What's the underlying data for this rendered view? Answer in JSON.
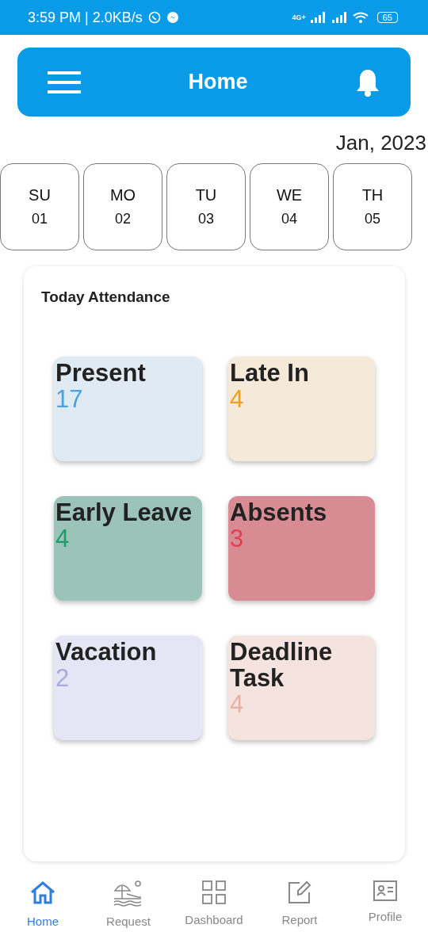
{
  "status_bar": {
    "time": "3:59 PM | 2.0KB/s",
    "network": "4G+",
    "battery": "65"
  },
  "header": {
    "title": "Home"
  },
  "month": "Jan, 2023",
  "days": [
    {
      "day": "SU",
      "date": "01"
    },
    {
      "day": "MO",
      "date": "02"
    },
    {
      "day": "TU",
      "date": "03"
    },
    {
      "day": "WE",
      "date": "04"
    },
    {
      "day": "TH",
      "date": "05"
    }
  ],
  "attendance": {
    "title": "Today Attendance",
    "cards": [
      {
        "label": "Present",
        "color": "#e0eaf2",
        "count": {
          "value": "17",
          "color": "#4aa3df"
        }
      },
      {
        "label": "Late In",
        "color": "#f5eada",
        "count": {
          "value": "4",
          "color": "#f0a020"
        }
      },
      {
        "label": "Early Leave",
        "color": "#9bc3b8",
        "count": {
          "value": "4",
          "color": "#1a9e6a"
        }
      },
      {
        "label": "Absents",
        "color": "#d98b93",
        "count": {
          "value": "3",
          "color": "#e0404e"
        }
      },
      {
        "label": "Vacation",
        "color": "#e6e5f5",
        "count": {
          "value": "2",
          "color": "#a9a9dc"
        }
      },
      {
        "label": "Deadline Task",
        "color": "#f5e3df",
        "count": {
          "value": "4",
          "color": "#e8b0a0"
        }
      }
    ]
  },
  "nav": [
    {
      "label": "Home",
      "kind": "home",
      "selected": true
    },
    {
      "label": "Request",
      "kind": "beach",
      "selected": false
    },
    {
      "label": "Dashboard",
      "kind": "grid",
      "selected": false
    },
    {
      "label": "Report",
      "kind": "edit",
      "selected": false
    },
    {
      "label": "Profile",
      "kind": "card",
      "selected": false
    }
  ]
}
